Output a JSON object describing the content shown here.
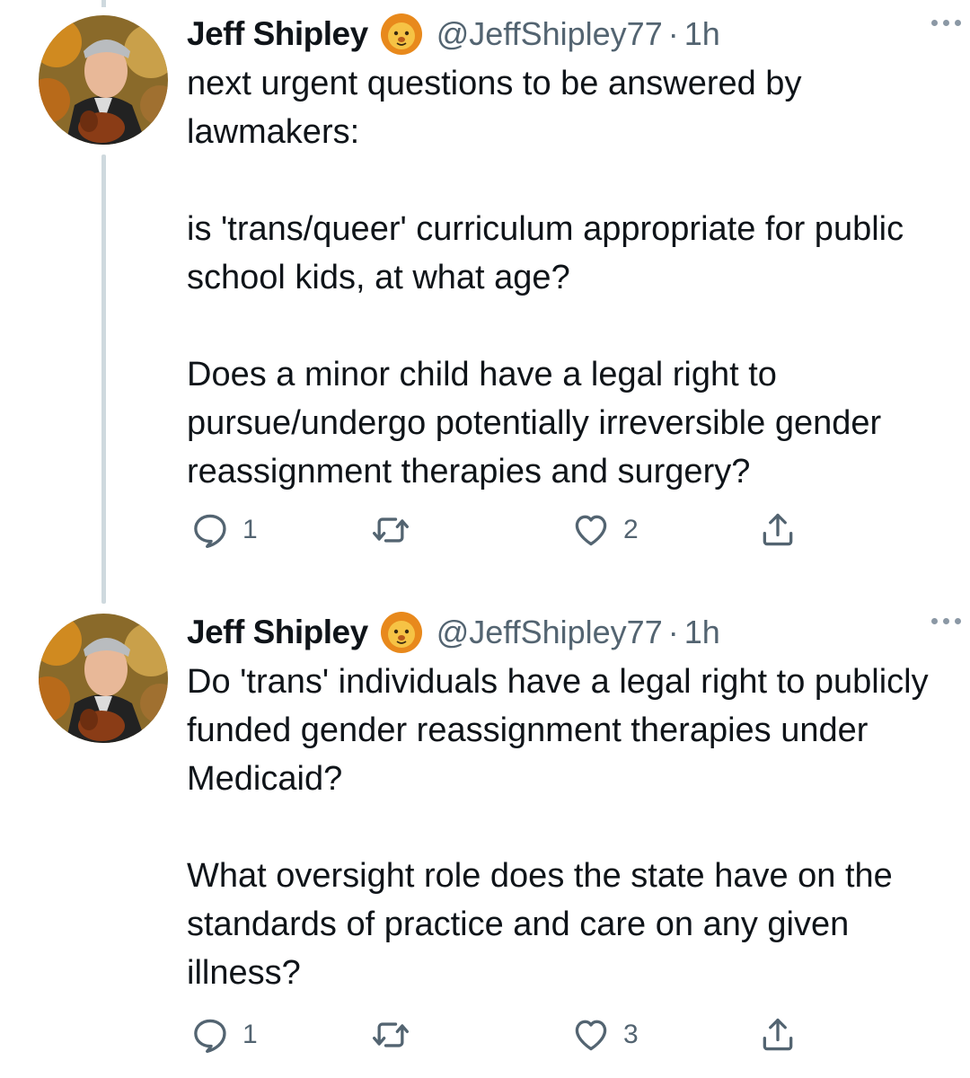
{
  "thread": {
    "tweets": [
      {
        "author": {
          "name": "Jeff Shipley",
          "handle": "@JeffShipley77",
          "badge_icon": "lion-emoji-icon"
        },
        "separator": "·",
        "time": "1h",
        "paragraphs": [
          "next urgent questions to be answered by lawmakers:",
          "is 'trans/queer' curriculum appropriate for public school kids, at what age?",
          "Does a minor child have a legal right to pursue/undergo potentially irreversible gender reassignment therapies and surgery?"
        ],
        "replies": "1",
        "retweets": "",
        "likes": "2"
      },
      {
        "author": {
          "name": "Jeff Shipley",
          "handle": "@JeffShipley77",
          "badge_icon": "lion-emoji-icon"
        },
        "separator": "·",
        "time": "1h",
        "paragraphs": [
          "Do 'trans' individuals have a legal right to publicly funded gender reassignment therapies under Medicaid?",
          "What oversight role does the state have on the standards of practice and care on any given illness?"
        ],
        "replies": "1",
        "retweets": "",
        "likes": "3"
      }
    ]
  },
  "colors": {
    "text": "#0f1419",
    "secondary": "#536471",
    "thread_line": "#cfd9de",
    "badge": "#f4a52b"
  },
  "icons": {
    "reply": "reply-icon",
    "retweet": "retweet-icon",
    "like": "heart-icon",
    "share": "share-icon",
    "more": "more-options-icon"
  }
}
